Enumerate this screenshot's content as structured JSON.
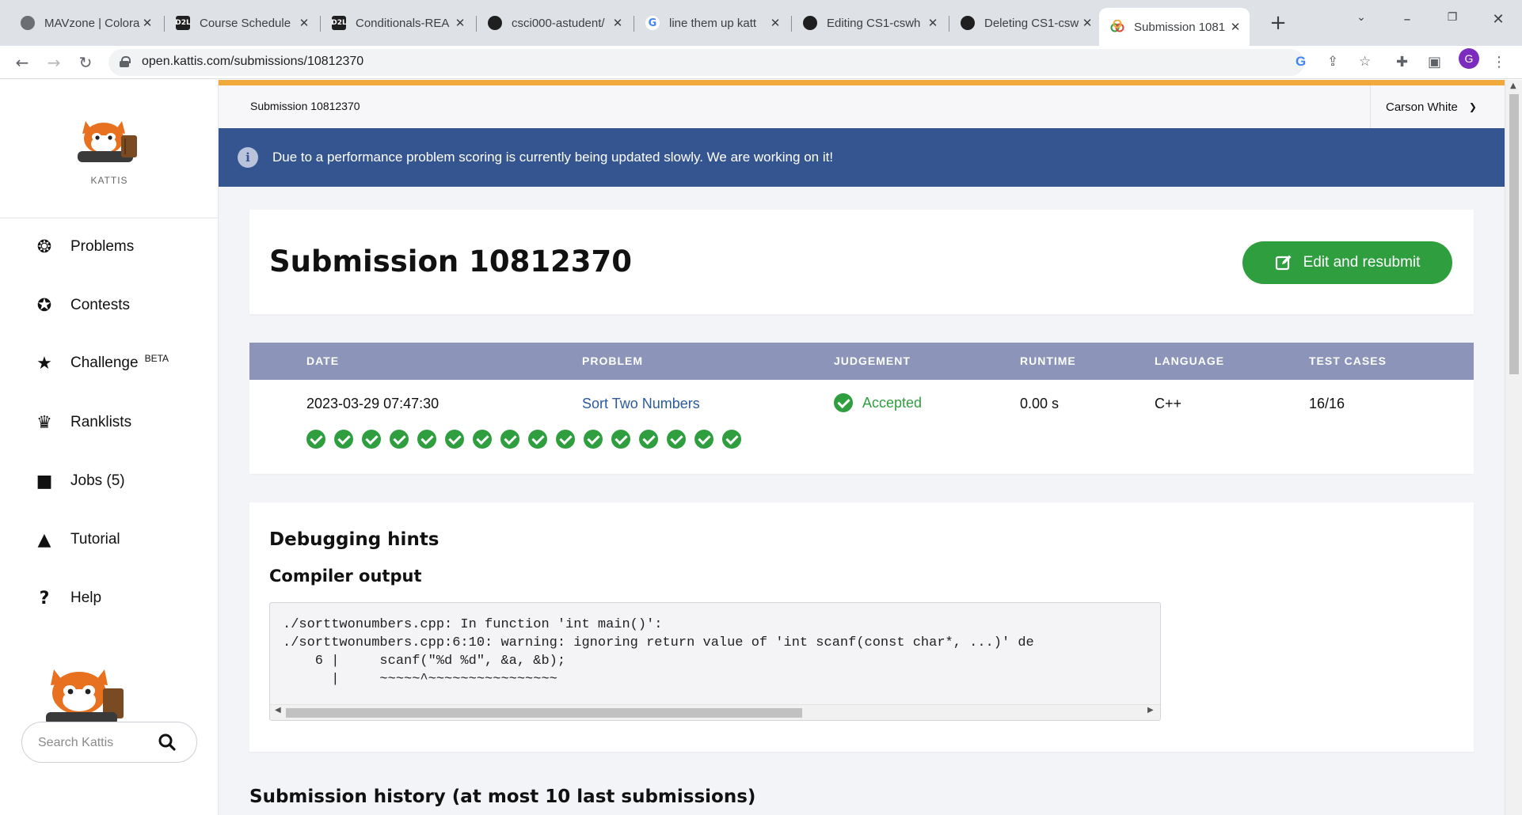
{
  "browser": {
    "tabs": [
      {
        "title": "MAVzone | Colora",
        "favicon": "mavzone-favicon",
        "favicon_color": "#6b6e73"
      },
      {
        "title": "Course Schedule",
        "favicon": "d2l-favicon",
        "favicon_color": "#1f1f1f"
      },
      {
        "title": "Conditionals-REA",
        "favicon": "d2l-favicon",
        "favicon_color": "#1f1f1f"
      },
      {
        "title": "csci000-astudent/",
        "favicon": "github-favicon",
        "favicon_color": "#1f1f1f"
      },
      {
        "title": "line them up katt",
        "favicon": "google-favicon",
        "favicon_color": "#ffffff"
      },
      {
        "title": "Editing CS1-cswh",
        "favicon": "github-favicon",
        "favicon_color": "#1f1f1f"
      },
      {
        "title": "Deleting CS1-csw",
        "favicon": "github-favicon",
        "favicon_color": "#1f1f1f"
      },
      {
        "title": "Submission 1081",
        "favicon": "kattis-favicon",
        "favicon_color": "#ffffff",
        "active": true
      }
    ],
    "url": "open.kattis.com/submissions/10812370",
    "profile_initial": "G"
  },
  "sidebar": {
    "logo_text": "KATTIS",
    "items": [
      {
        "label": "Problems",
        "icon": "brain-icon",
        "glyph": "❂"
      },
      {
        "label": "Contests",
        "icon": "medal-icon",
        "glyph": "✪"
      },
      {
        "label": "Challenge",
        "icon": "star-icon",
        "glyph": "★",
        "badge": "BETA"
      },
      {
        "label": "Ranklists",
        "icon": "trophy-icon",
        "glyph": "♛"
      },
      {
        "label": "Jobs (5)",
        "icon": "briefcase-icon",
        "glyph": "■"
      },
      {
        "label": "Tutorial",
        "icon": "graduation-cap-icon",
        "glyph": "▲"
      },
      {
        "label": "Help",
        "icon": "question-icon",
        "glyph": "?"
      }
    ],
    "search_placeholder": "Search Kattis"
  },
  "header": {
    "breadcrumb": "Submission 10812370",
    "user": "Carson White",
    "accent": "#f2a93b"
  },
  "banner": {
    "text": "Due to a performance problem scoring is currently being updated slowly. We are working on it!",
    "color": "#355591"
  },
  "submission": {
    "title": "Submission 10812370",
    "edit_button": "Edit and resubmit",
    "columns": [
      "DATE",
      "PROBLEM",
      "JUDGEMENT",
      "RUNTIME",
      "LANGUAGE",
      "TEST CASES"
    ],
    "row": {
      "date": "2023-03-29 07:47:30",
      "problem": "Sort Two Numbers",
      "judgement": "Accepted",
      "runtime": "0.00 s",
      "language": "C++",
      "test_cases": "16/16"
    },
    "test_results_passed": 16,
    "accepted_color": "#2f9e3f"
  },
  "debug": {
    "title": "Debugging hints",
    "compiler_title": "Compiler output",
    "output_lines": [
      "./sorttwonumbers.cpp: In function 'int main()':",
      "./sorttwonumbers.cpp:6:10: warning: ignoring return value of 'int scanf(const char*, ...)' de",
      "    6 |     scanf(\"%d %d\", &a, &b);",
      "      |     ~~~~~^~~~~~~~~~~~~~~~~"
    ]
  },
  "history": {
    "title": "Submission history (at most 10 last submissions)"
  }
}
